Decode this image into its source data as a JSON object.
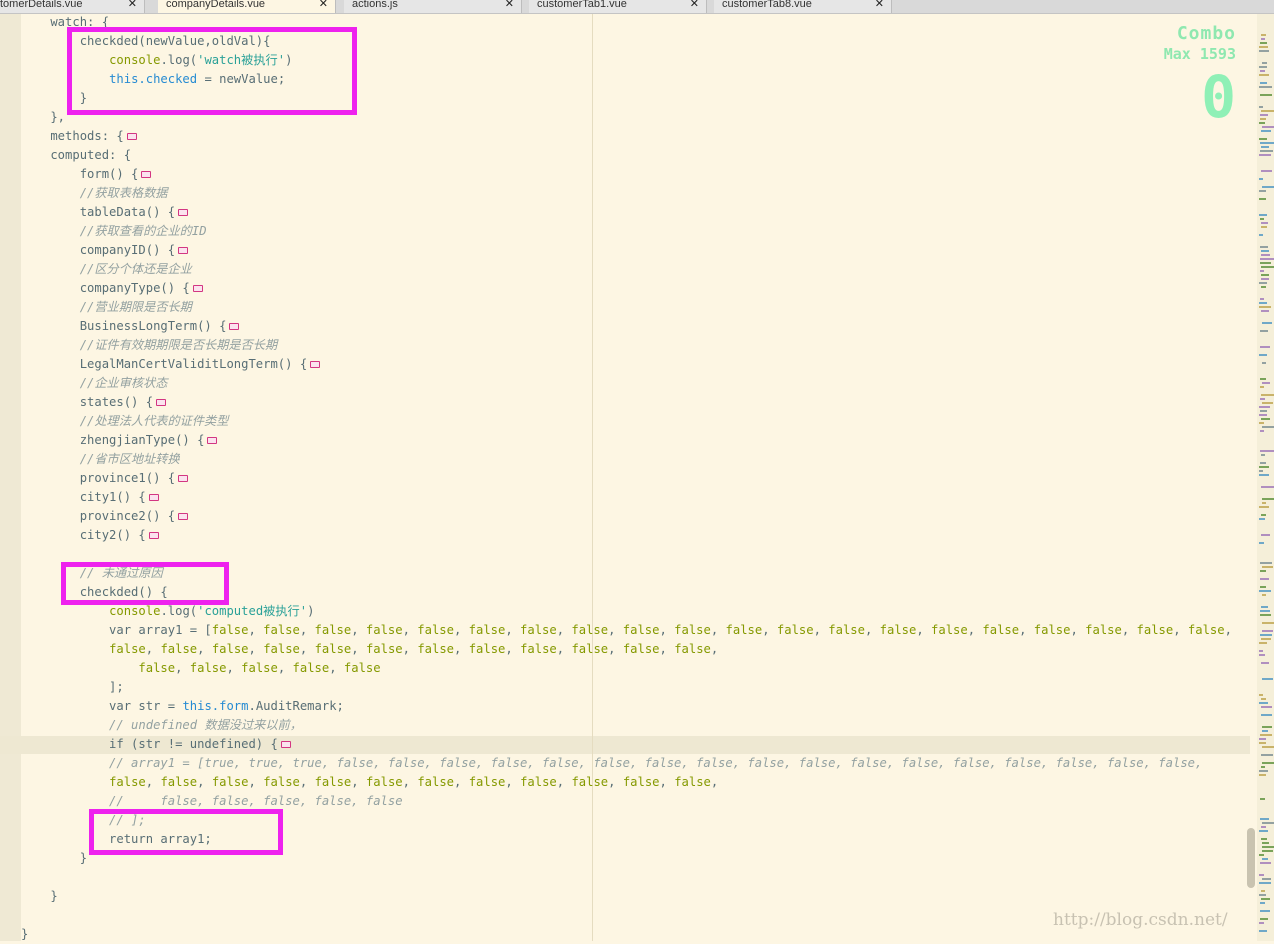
{
  "tabs": [
    {
      "label": "tomerDetails.vue",
      "close": "✕"
    },
    {
      "label": "companyDetails.vue",
      "close": "✕",
      "active": true
    },
    {
      "label": "actions.js",
      "close": "✕"
    },
    {
      "label": "customerTab1.vue",
      "close": "✕"
    },
    {
      "label": "customerTab8.vue",
      "close": "✕"
    }
  ],
  "combo": {
    "title": "Combo",
    "max": "Max 1593",
    "count": "0"
  },
  "watermark": "http://blog.csdn.net/",
  "colors": {
    "highlight_box": "#ee22ee",
    "background": "#fdf6e3",
    "combo": "#8fe8b0"
  },
  "code_lines": [
    "    watch: {",
    "        checkded(newValue,oldVal){",
    "            console.log('watch被执行')",
    "            this.checked = newValue;",
    "        }",
    "    },",
    "    methods: {",
    "    computed: {",
    "        form() {",
    "        //获取表格数据",
    "        tableData() {",
    "        //获取查看的企业的ID",
    "        companyID() {",
    "        //区分个体还是企业",
    "        companyType() {",
    "        //营业期限是否长期",
    "        BusinessLongTerm() {",
    "        //证件有效期期限是否长期是否长期",
    "        LegalManCertValiditLongTerm() {",
    "        //企业审核状态",
    "        states() {",
    "        //处理法人代表的证件类型",
    "        zhengjianType() {",
    "        //省市区地址转换",
    "        province1() {",
    "        city1() {",
    "        province2() {",
    "        city2() {",
    "",
    "        // 未通过原因",
    "        checkded() {",
    "            console.log('computed被执行')",
    "            var array1 = [false, false, false, false, false, false, false, false, false, false, false, false, false, false, false, false, false, false, false, false,",
    "            false, false, false, false, false, false, false, false, false, false, false, false,",
    "                false, false, false, false, false",
    "            ];",
    "            var str = this.form.AuditRemark;",
    "            // undefined 数据没过来以前，",
    "            if (str != undefined) {",
    "            // array1 = [true, true, true, false, false, false, false, false, false, false, false, false, false, false, false, false, false, false, false, false,",
    "            false, false, false, false, false, false, false, false, false, false, false, false,",
    "            //     false, false, false, false, false",
    "            // ];",
    "            return array1;",
    "        }",
    "",
    "    }",
    "",
    "}"
  ]
}
